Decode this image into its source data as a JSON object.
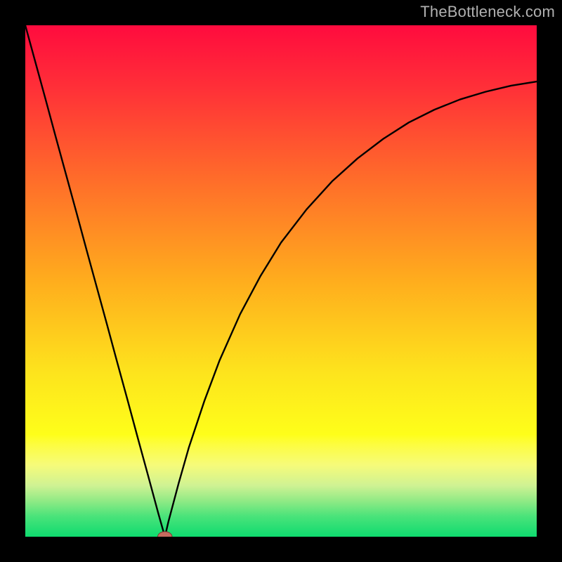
{
  "watermark": "TheBottleneck.com",
  "chart_data": {
    "type": "line",
    "title": "",
    "xlabel": "",
    "ylabel": "",
    "xlim": [
      0,
      100
    ],
    "ylim": [
      0,
      100
    ],
    "colors": {
      "top": "#ff0c3e",
      "mid": "#fefe1a",
      "bottom": "#13e071",
      "curve": "#000000",
      "marker_fill": "#c66b5f",
      "marker_stroke": "#7a3a34",
      "outer_background": "#000000"
    },
    "background_gradient_stops": [
      {
        "offset": 0.0,
        "color": "#ff0b3e"
      },
      {
        "offset": 0.12,
        "color": "#ff2f38"
      },
      {
        "offset": 0.3,
        "color": "#ff6c2a"
      },
      {
        "offset": 0.5,
        "color": "#ffad1d"
      },
      {
        "offset": 0.68,
        "color": "#fde41d"
      },
      {
        "offset": 0.8,
        "color": "#fefe1a"
      },
      {
        "offset": 0.82,
        "color": "#fdfd40"
      },
      {
        "offset": 0.86,
        "color": "#f6fb7a"
      },
      {
        "offset": 0.9,
        "color": "#cff293"
      },
      {
        "offset": 0.93,
        "color": "#90ea85"
      },
      {
        "offset": 0.96,
        "color": "#4ae37a"
      },
      {
        "offset": 1.0,
        "color": "#0fdb6f"
      }
    ],
    "series": [
      {
        "name": "curve",
        "x": [
          0,
          2,
          4,
          6,
          8,
          10,
          12,
          14,
          16,
          18,
          20,
          22,
          24,
          26,
          27.3,
          28,
          30,
          32,
          35,
          38,
          42,
          46,
          50,
          55,
          60,
          65,
          70,
          75,
          80,
          85,
          90,
          95,
          100
        ],
        "y": [
          100,
          92.7,
          85.4,
          78.0,
          70.7,
          63.4,
          56.0,
          48.7,
          41.4,
          34.0,
          26.7,
          19.3,
          12.0,
          4.6,
          0.0,
          3.0,
          10.5,
          17.5,
          26.5,
          34.5,
          43.5,
          51.0,
          57.5,
          64.0,
          69.5,
          74.0,
          77.8,
          81.0,
          83.5,
          85.5,
          87.0,
          88.2,
          89.0
        ]
      }
    ],
    "marker": {
      "x": 27.3,
      "y": 0.0,
      "rx": 1.4,
      "ry": 1.0
    }
  }
}
